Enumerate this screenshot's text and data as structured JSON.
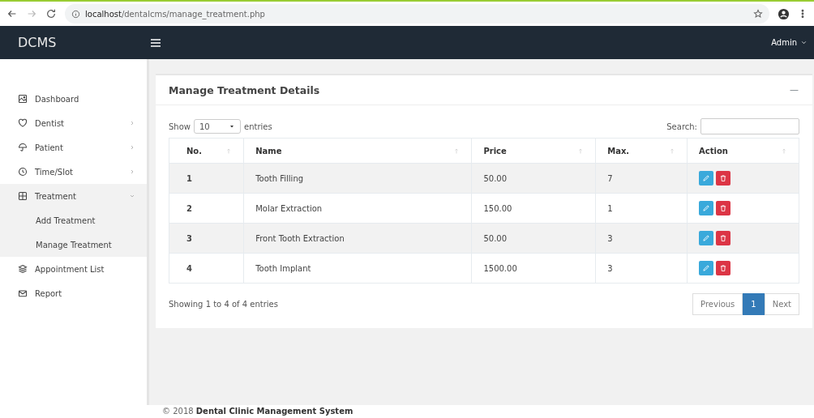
{
  "browser": {
    "url_host": "localhost",
    "url_path": "/dentalcms/manage_treatment.php"
  },
  "brand": "DCMS",
  "user_menu": "Admin",
  "sidebar": {
    "items": [
      {
        "label": "Dashboard",
        "kind": "link"
      },
      {
        "label": "Dentist",
        "kind": "menu",
        "expanded": false
      },
      {
        "label": "Patient",
        "kind": "menu",
        "expanded": false
      },
      {
        "label": "Time/Slot",
        "kind": "menu",
        "expanded": false
      },
      {
        "label": "Treatment",
        "kind": "menu",
        "expanded": true,
        "children": [
          {
            "label": "Add Treatment"
          },
          {
            "label": "Manage Treatment"
          }
        ]
      },
      {
        "label": "Appointment List",
        "kind": "link"
      },
      {
        "label": "Report",
        "kind": "link"
      }
    ]
  },
  "card": {
    "title": "Manage Treatment Details",
    "collapse": "—",
    "length": {
      "before": "Show",
      "value": "10",
      "after": "entries"
    },
    "search_label": "Search:",
    "table": {
      "columns": [
        "No.",
        "Name",
        "Price",
        "Max.",
        "Action"
      ],
      "rows": [
        {
          "no": "1",
          "name": "Tooth Filling",
          "price": "50.00",
          "max": "7"
        },
        {
          "no": "2",
          "name": "Molar Extraction",
          "price": "150.00",
          "max": "1"
        },
        {
          "no": "3",
          "name": "Front Tooth Extraction",
          "price": "50.00",
          "max": "3"
        },
        {
          "no": "4",
          "name": "Tooth Implant",
          "price": "1500.00",
          "max": "3"
        }
      ]
    },
    "info": "Showing 1 to 4 of 4 entries",
    "pagination": [
      {
        "label": "Previous",
        "selected": false
      },
      {
        "label": "1",
        "selected": true
      },
      {
        "label": "Next",
        "selected": false
      }
    ]
  },
  "footer": {
    "year": "© 2018",
    "name": "Dental Clinic Management System"
  }
}
